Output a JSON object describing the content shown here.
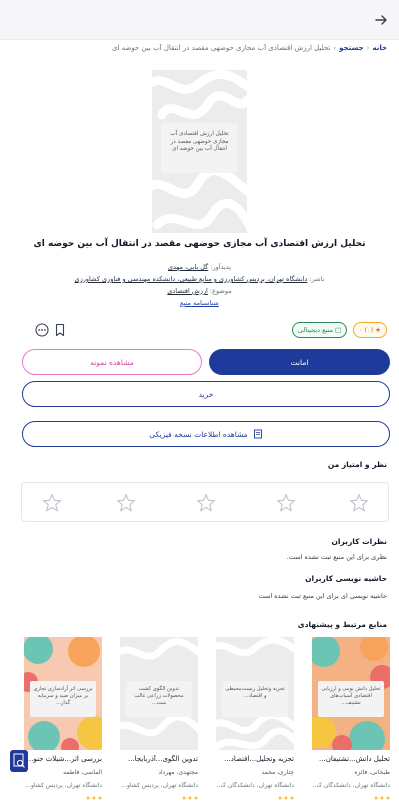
{
  "topbar": {
    "back_icon": "arrow-right-icon"
  },
  "breadcrumb": {
    "home": "خانه",
    "search": "جستجو",
    "current": "تحلیل ارزش اقتصادی آب مجازی حوضهی مقصد در انتقال آب بین حوضه ای"
  },
  "book": {
    "cover_text": "تحلیل ارزش اقتصادی آب مجازی حوضهی مقصد در انتقال آب بین حوضه ای",
    "title": "تحلیل ارزش اقتصادی آب مجازی حوضهی مقصد در انتقال آب بین حوضه ای",
    "creator_label": "پدیدآور:",
    "creator_value": "گل بابی، مهدی",
    "publisher_label": "ناشر:",
    "publisher_value": "دانشگاه تهران، پردیس کشاورزی و منابع طبیعی، دانشکده مهندسی و فناوری کشاورزی",
    "subject_label": "موضوع:",
    "subject_value": "ارزش اقتصادی",
    "identity_link": "شناسنامه منبع"
  },
  "badges": {
    "rating": "(۰) ۰",
    "digital": "منبع دیجیتالی"
  },
  "buttons": {
    "loan": "امانت",
    "sample": "مشاهده نمونه",
    "buy": "خرید",
    "physical": "مشاهده اطلاعات نسخه فیزیکی"
  },
  "rating_section": {
    "title": "نظر و امتیاز من",
    "stars": [
      1,
      2,
      3,
      4,
      5
    ]
  },
  "comments": {
    "title": "نظرات کاربران",
    "empty": "نظری برای این منبع ثبت نشده است."
  },
  "annotations": {
    "title": "حاشیه نویسی کاربران",
    "empty": "حاشیه نویسی ای برای این منبع ثبت نشده است"
  },
  "related": {
    "title": "منابع مرتبط و پیشنهادی",
    "items": [
      {
        "cover_text": "تحلیل دانش بومی و ارزیابی اقتصادی آسیاب‌های تشتیف...",
        "title": "تحلیل دانش...تشتیفان...",
        "author": "طبخانی، فائزه",
        "university": "دانشگاه تهران، دانشکدگان ک...",
        "palette": "colorful"
      },
      {
        "cover_text": "تجزیه وتحلیل زیست‌محیطی و اقتصاد...",
        "title": "تجزیه وتحلیل...اقتصاد...",
        "author": "چتاری، محمد",
        "university": "دانشگاه تهران، دانشکدگان ک...",
        "palette": "gray"
      },
      {
        "cover_text": "تدوین الگوی کشت محصولات زراعی غالب مبت...",
        "title": "تدوین الگوی...آذربایجا...",
        "author": "مجتهدی، مهرداد",
        "university": "دانشگاه تهران، پردیس کشاو...",
        "palette": "gray"
      },
      {
        "cover_text": "بررسی اثر آزادسازی تجاری بر میزان صید و سرمایه گذار...",
        "title": "بررسی اثر...شیلات جنو...",
        "author": "الماسی، فاطمه",
        "university": "دانشگاه تهران، پردیس کشاو...",
        "palette": "colorful"
      }
    ]
  },
  "colors": {
    "primary": "#1e3a9a",
    "sample": "#e879c9",
    "rating": "#f5a623",
    "digital": "#2f855a"
  },
  "fab": {
    "icon": "document-search-icon"
  }
}
